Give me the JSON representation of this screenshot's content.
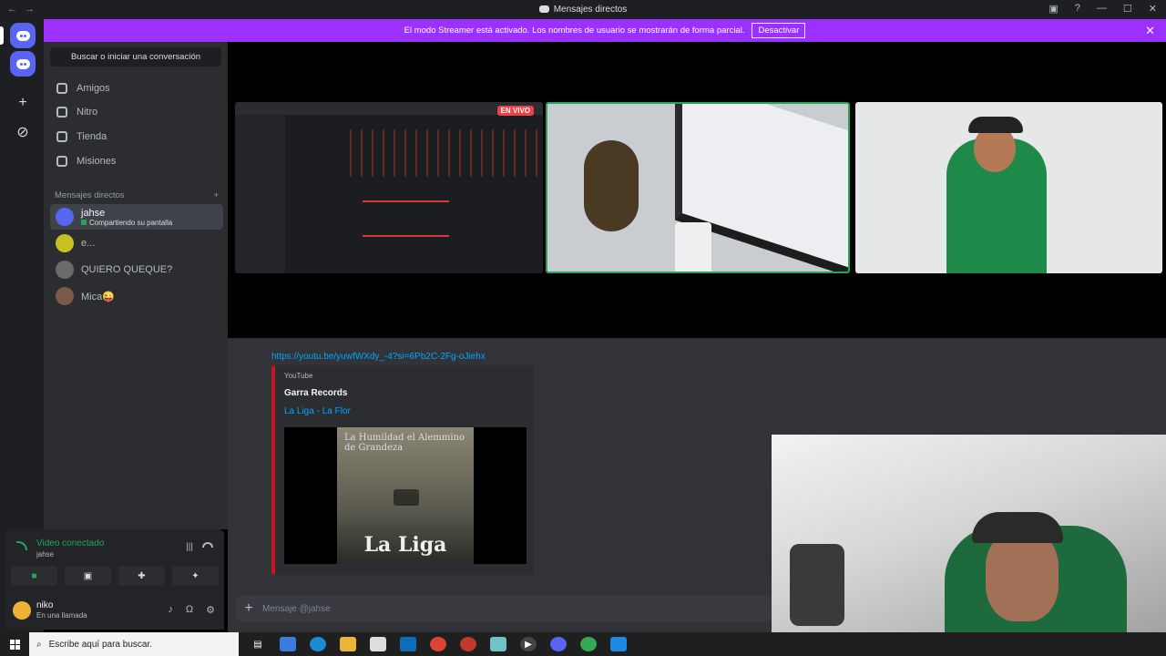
{
  "titlebar": {
    "title": "Mensajes directos",
    "back": "←",
    "forward": "→"
  },
  "banner": {
    "text": "El modo Streamer está activado. Los nombres de usuario se mostrarán de forma parcial.",
    "button": "Desactivar",
    "close": "✕"
  },
  "sidebar": {
    "search_placeholder": "Buscar o iniciar una conversación",
    "nav": [
      {
        "label": "Amigos"
      },
      {
        "label": "Nitro"
      },
      {
        "label": "Tienda"
      },
      {
        "label": "Misiones"
      }
    ],
    "dm_header": "Mensajes directos",
    "dm_add": "+",
    "dms": [
      {
        "name": "jahse",
        "status": "Compartiendo su pantalla",
        "active": true
      },
      {
        "name": "e..."
      },
      {
        "name": "QUIERO QUEQUE?"
      },
      {
        "name": "Mica😜"
      }
    ]
  },
  "stage": {
    "live_badge": "EN VIVO"
  },
  "chat": {
    "link": "https://youtu.be/yuwfWXdy_-4?si=6Pb2C-2Fg-oJiehx",
    "embed": {
      "provider": "YouTube",
      "author": "Garra Records",
      "title": "La Liga - La Flor",
      "cover_title": "La Liga",
      "cover_top": "La Humildad el Alemmino de Grandeza"
    },
    "input_placeholder": "Mensaje @jahse"
  },
  "rtc": {
    "status": "Video conectado",
    "channel": "jahse"
  },
  "user": {
    "name": "niko",
    "status": "En una llamada"
  },
  "taskbar": {
    "search": "Escribe aquí para buscar."
  },
  "colors": {
    "blurple": "#5865f2",
    "streamer": "#9b30ff",
    "green": "#23a55a",
    "live": "#ed4245",
    "link": "#00a8fc"
  }
}
